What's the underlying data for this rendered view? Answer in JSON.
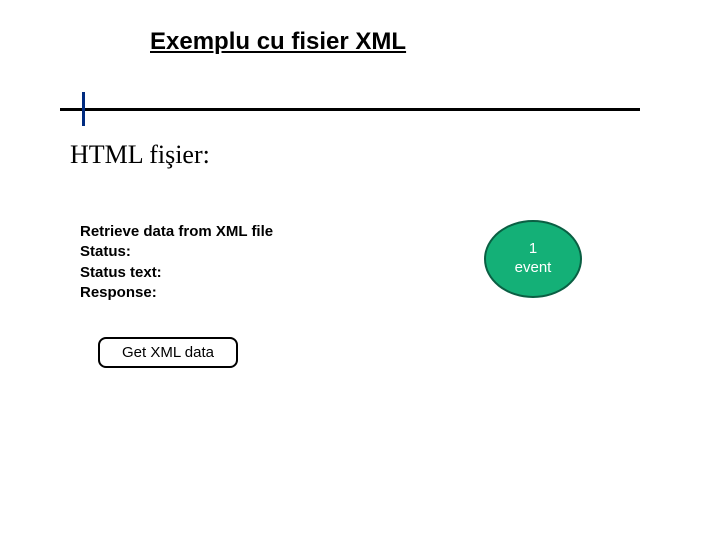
{
  "title": "Exemplu cu fisier XML",
  "section_heading": "HTML fişier:",
  "info": {
    "line1": "Retrieve data from XML file",
    "status_label": "Status:",
    "status_text_label": "Status text:",
    "response_label": "Response:"
  },
  "button": {
    "label": "Get XML data"
  },
  "badge": {
    "count": "1",
    "label": "event"
  }
}
